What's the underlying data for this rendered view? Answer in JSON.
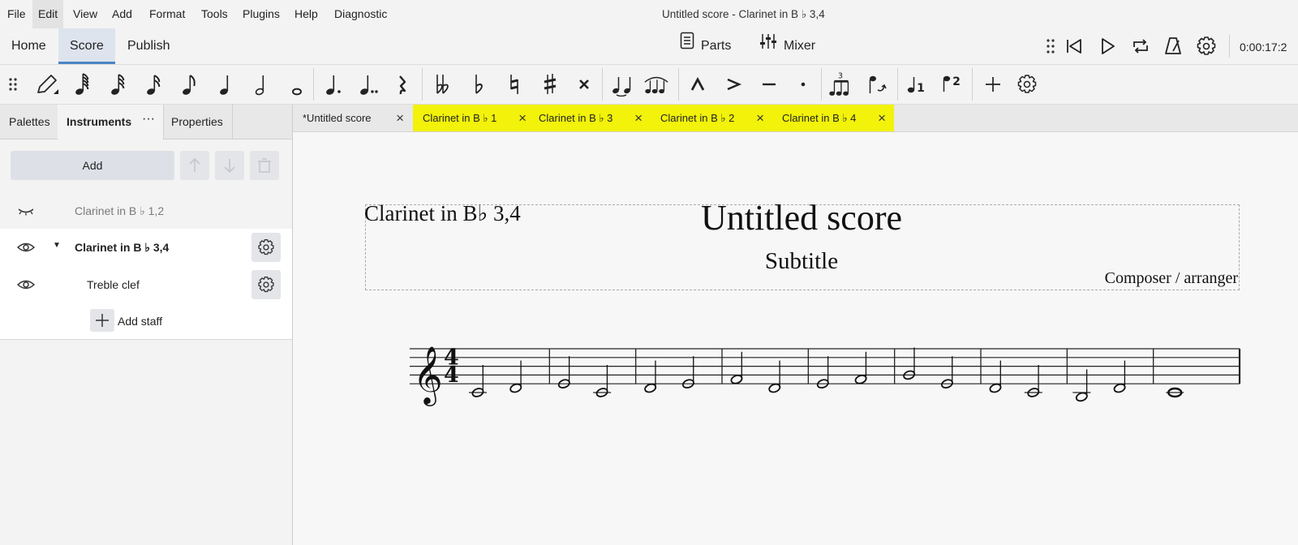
{
  "menu": {
    "items": [
      "File",
      "Edit",
      "View",
      "Add",
      "Format",
      "Tools",
      "Plugins",
      "Help",
      "Diagnostic"
    ],
    "active": "Edit"
  },
  "window_title": "Untitled score - Clarinet in B ♭ 3,4",
  "top_tabs": [
    "Home",
    "Score",
    "Publish"
  ],
  "center_buttons": {
    "parts": "Parts",
    "mixer": "Mixer"
  },
  "playback": {
    "time": "0:00:17:2"
  },
  "toolbar": {
    "tools": [
      "drag-handle-icon",
      "note-input-pencil-icon",
      "64th-note-icon",
      "32nd-note-icon",
      "16th-note-icon",
      "eighth-note-icon",
      "quarter-note-icon",
      "half-note-icon",
      "whole-note-icon",
      "dot-icon",
      "double-dot-icon",
      "rest-icon",
      "double-flat-icon",
      "flat-icon",
      "natural-icon",
      "sharp-icon",
      "double-sharp-icon",
      "tie-icon",
      "slur-icon",
      "marcato-icon",
      "accent-icon",
      "tenuto-icon",
      "staccato-icon",
      "tuplet-icon",
      "flip-direction-icon",
      "voice-1-icon",
      "voice-2-icon",
      "add-icon",
      "customize-toolbar-icon"
    ]
  },
  "left_panel": {
    "tabs": [
      "Palettes",
      "Instruments",
      "Properties"
    ],
    "active_tab": "Instruments",
    "more_label": "···",
    "add_label": "Add",
    "instruments": [
      {
        "label": "Clarinet in B ♭ 1,2",
        "visible": false,
        "selected": false
      },
      {
        "label": "Clarinet in B ♭ 3,4",
        "visible": true,
        "selected": true,
        "expanded": true
      }
    ],
    "staff_row": {
      "label": "Treble clef"
    },
    "add_staff_label": "Add staff"
  },
  "doc_tabs": [
    {
      "label": "*Untitled score",
      "highlighted": false
    },
    {
      "label": "Clarinet in B ♭  1",
      "highlighted": true
    },
    {
      "label": "Clarinet in B ♭  3",
      "highlighted": true
    },
    {
      "label": "Clarinet in B ♭  2",
      "highlighted": true
    },
    {
      "label": "Clarinet in B ♭  4",
      "highlighted": true
    }
  ],
  "highlight_color": "#f2f20a",
  "accent_color": "#4b83c6",
  "score": {
    "part_name": "Clarinet in B♭ 3,4",
    "title": "Untitled score",
    "subtitle": "Subtitle",
    "composer": "Composer / arranger",
    "time_signature": {
      "top": "4",
      "bottom": "4"
    },
    "clef": "treble",
    "measures": [
      {
        "notes": [
          {
            "pitch": "C4",
            "value": "half"
          },
          {
            "pitch": "D4",
            "value": "half"
          }
        ]
      },
      {
        "notes": [
          {
            "pitch": "E4",
            "value": "half"
          },
          {
            "pitch": "C4",
            "value": "half"
          }
        ]
      },
      {
        "notes": [
          {
            "pitch": "D4",
            "value": "half"
          },
          {
            "pitch": "E4",
            "value": "half"
          }
        ]
      },
      {
        "notes": [
          {
            "pitch": "F4",
            "value": "half"
          },
          {
            "pitch": "D4",
            "value": "half"
          }
        ]
      },
      {
        "notes": [
          {
            "pitch": "E4",
            "value": "half"
          },
          {
            "pitch": "F4",
            "value": "half"
          }
        ]
      },
      {
        "notes": [
          {
            "pitch": "G4",
            "value": "half"
          },
          {
            "pitch": "E4",
            "value": "half"
          }
        ]
      },
      {
        "notes": [
          {
            "pitch": "D4",
            "value": "half"
          },
          {
            "pitch": "C4",
            "value": "half"
          }
        ]
      },
      {
        "notes": [
          {
            "pitch": "B3",
            "value": "half"
          },
          {
            "pitch": "D4",
            "value": "half"
          }
        ]
      },
      {
        "notes": [
          {
            "pitch": "C4",
            "value": "whole"
          }
        ]
      }
    ]
  }
}
